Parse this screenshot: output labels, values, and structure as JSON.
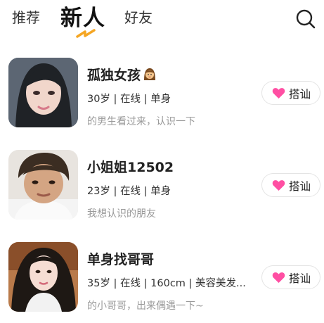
{
  "header": {
    "tabs": [
      {
        "label": "推荐",
        "active": false
      },
      {
        "label": "新人",
        "active": true
      },
      {
        "label": "好友",
        "active": false
      }
    ],
    "accent_color": "#f5a623",
    "search_icon": "search-icon"
  },
  "users": [
    {
      "name": "孤独女孩",
      "name_emoji": "girl-emoji",
      "meta": "30岁 | 在线 | 单身",
      "bio": "的男生看过来，认识一下",
      "action": "搭讪"
    },
    {
      "name": "小姐姐12502",
      "meta": "23岁 | 在线 | 单身",
      "bio": "我想认识的朋友",
      "action": "搭讪"
    },
    {
      "name": "单身找哥哥",
      "meta": "35岁 | 在线 | 160cm | 美容美发...",
      "bio": "的小哥哥，出来偶遇一下~",
      "action": "搭讪"
    }
  ],
  "heart_color": "#ff4fa3"
}
